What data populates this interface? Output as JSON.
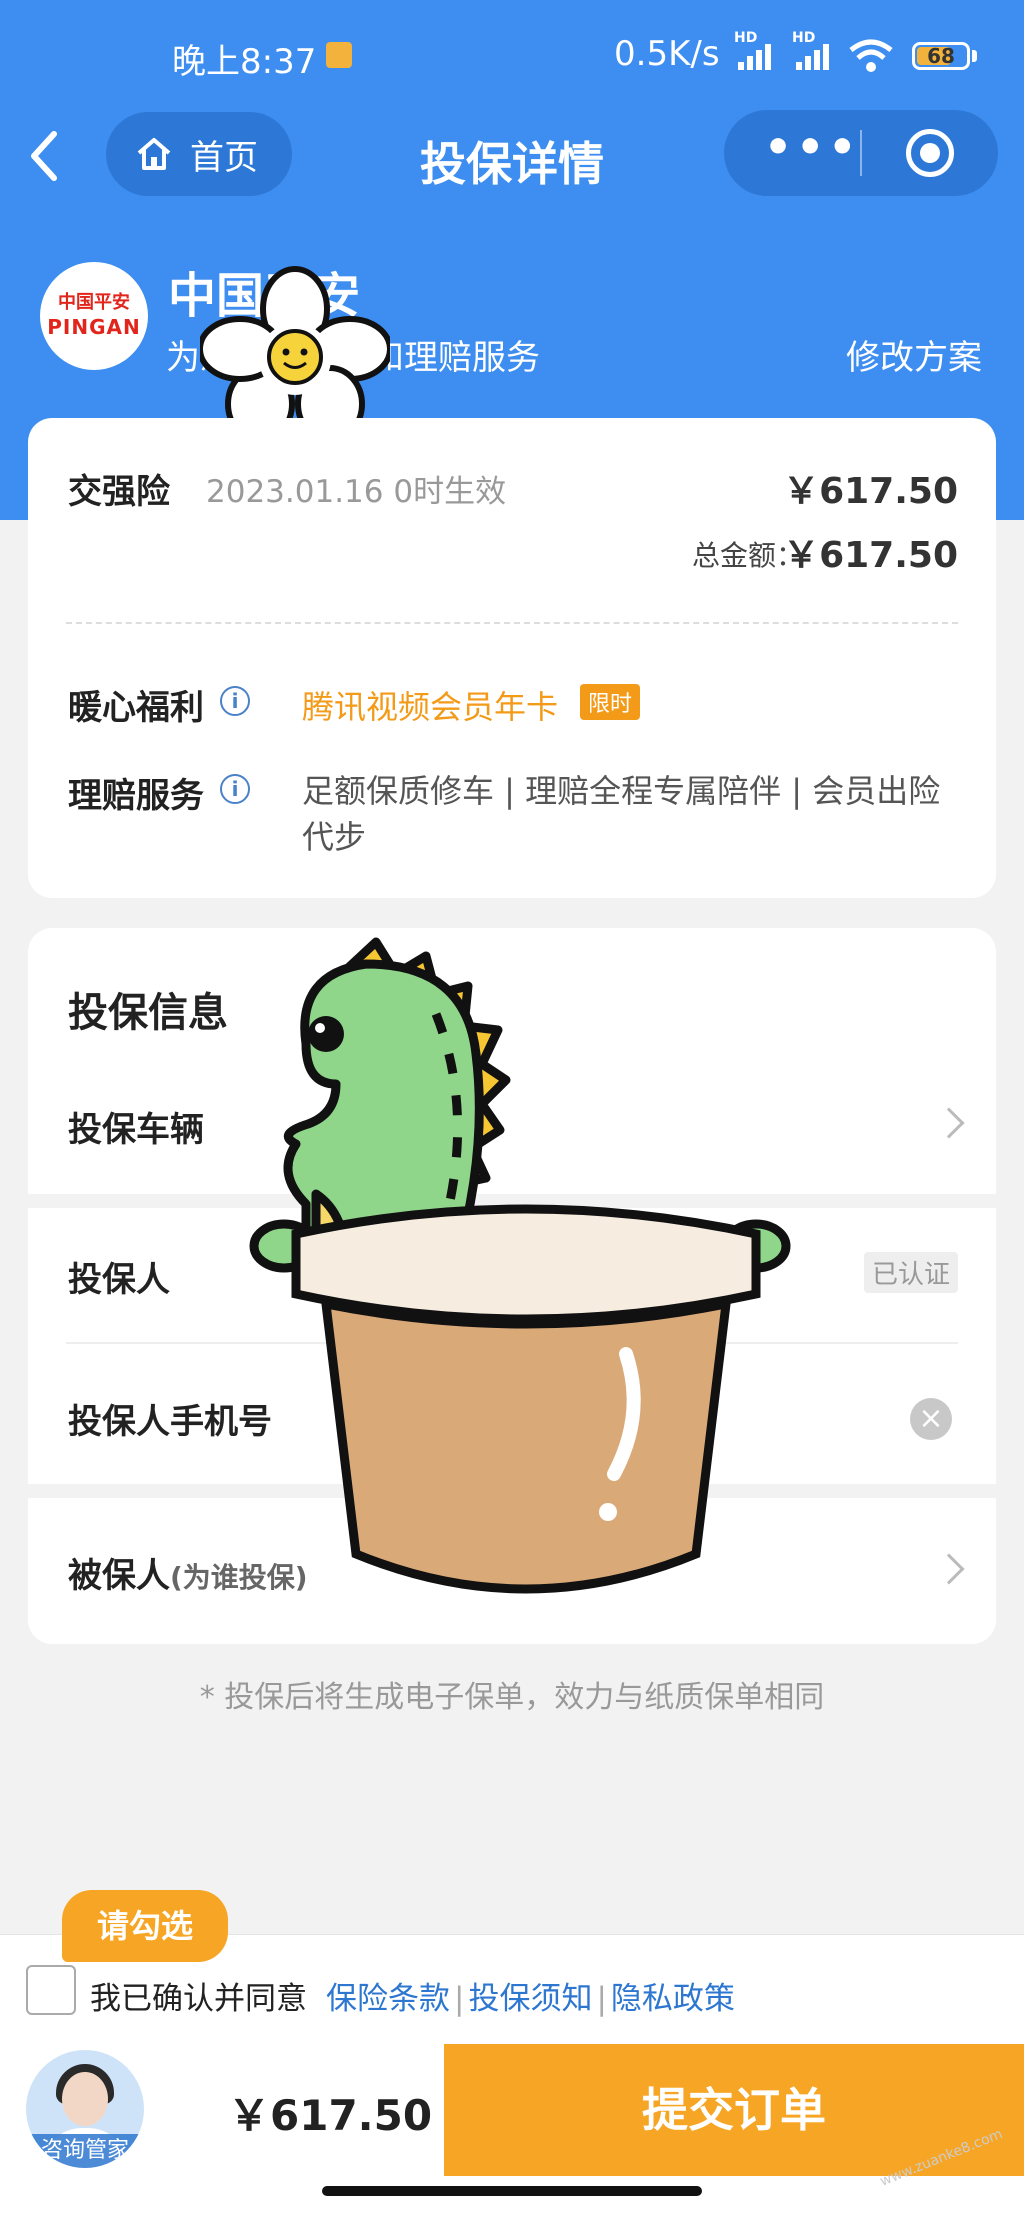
{
  "status_bar": {
    "time": "晚上8:37",
    "net_speed": "0.5K/s",
    "battery": "68",
    "hd1": "HD",
    "hd2": "HD"
  },
  "nav": {
    "home_label": "首页",
    "title": "投保详情"
  },
  "insurer": {
    "logo_line1": "中国平安",
    "logo_line2": "PINGAN",
    "name": "中国平安",
    "desc": "为您提供承保和理赔服务",
    "modify": "修改方案"
  },
  "policy": {
    "name": "交强险",
    "effective": "2023.01.16 0时生效",
    "price": "￥617.50",
    "total_label": "总金额：",
    "total_value": "￥617.50"
  },
  "benefit": {
    "label": "暖心福利",
    "value": "腾讯视频会员年卡",
    "badge": "限时"
  },
  "service": {
    "label": "理赔服务",
    "value": "足额保质修车 | 理赔全程专属陪伴 | 会员出险代步"
  },
  "info_section": {
    "title": "投保信息",
    "vehicle": "投保车辆",
    "applicant": "投保人",
    "verified": "已认证",
    "phone": "投保人手机号",
    "insured": "被保人",
    "insured_hint": "(为谁投保)"
  },
  "note": "* 投保后将生成电子保单，效力与纸质保单相同",
  "agreement": {
    "tooltip": "请勾选",
    "text": "我已确认并同意",
    "links": [
      "保险条款",
      "投保须知",
      "隐私政策"
    ]
  },
  "footer": {
    "avatar_label": "咨询管家",
    "price": "￥617.50",
    "submit": "提交订单"
  },
  "watermark": "www.zuanke8.com",
  "colors": {
    "primary_blue": "#3d8ef0",
    "orange": "#f7a524",
    "link": "#2e77d0"
  }
}
